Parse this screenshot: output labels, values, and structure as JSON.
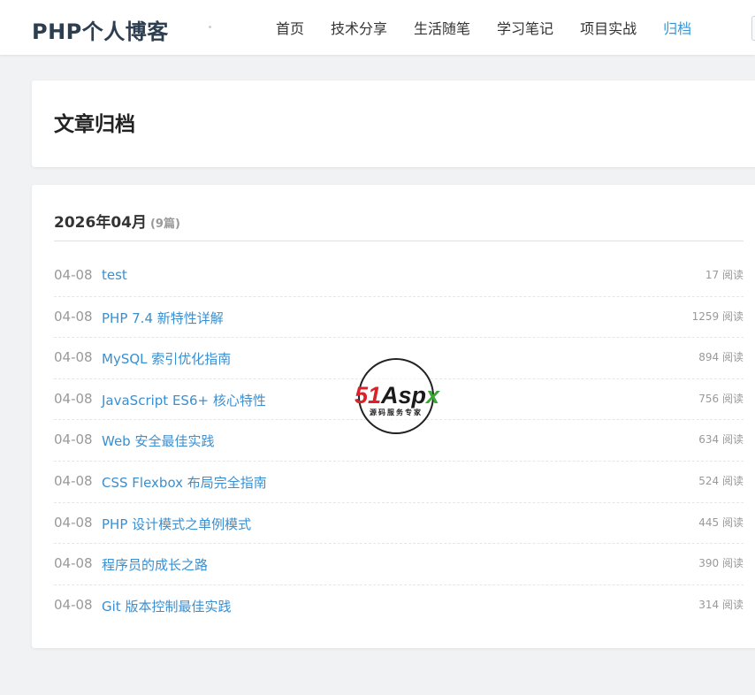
{
  "header": {
    "logo": "PHP个人博客",
    "nav": [
      {
        "label": "首页"
      },
      {
        "label": "技术分享"
      },
      {
        "label": "生活随笔"
      },
      {
        "label": "学习笔记"
      },
      {
        "label": "项目实战"
      },
      {
        "label": "归档"
      }
    ],
    "active_index": 5,
    "accent_color": "#3498db"
  },
  "page": {
    "title": "文章归档"
  },
  "archive": {
    "month": "2026年04月",
    "count": "(9篇)",
    "items": [
      {
        "date": "04-08",
        "title": "test",
        "views": "17 阅读"
      },
      {
        "date": "04-08",
        "title": "PHP 7.4 新特性详解",
        "views": "1259 阅读"
      },
      {
        "date": "04-08",
        "title": "MySQL 索引优化指南",
        "views": "894 阅读"
      },
      {
        "date": "04-08",
        "title": "JavaScript ES6+ 核心特性",
        "views": "756 阅读"
      },
      {
        "date": "04-08",
        "title": "Web 安全最佳实践",
        "views": "634 阅读"
      },
      {
        "date": "04-08",
        "title": "CSS Flexbox 布局完全指南",
        "views": "524 阅读"
      },
      {
        "date": "04-08",
        "title": "PHP 设计模式之单例模式",
        "views": "445 阅读"
      },
      {
        "date": "04-08",
        "title": "程序员的成长之路",
        "views": "390 阅读"
      },
      {
        "date": "04-08",
        "title": "Git 版本控制最佳实践",
        "views": "314 阅读"
      }
    ]
  },
  "watermark": {
    "brand": "51Aspx",
    "tagline": "源码服务专家"
  }
}
